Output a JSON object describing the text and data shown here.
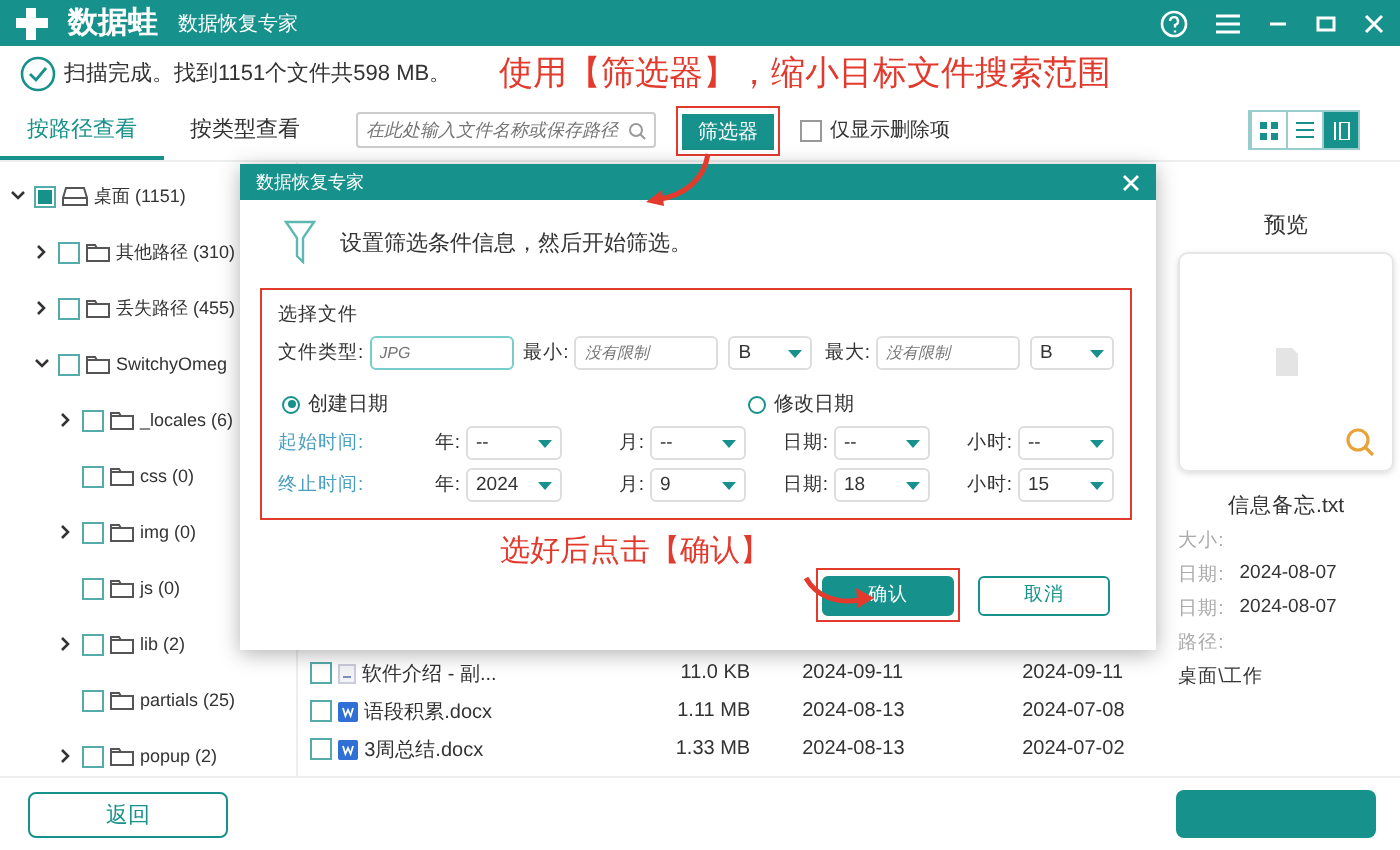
{
  "window": {
    "brand": "数据蛙",
    "title": "数据恢复专家"
  },
  "status": {
    "text": "扫描完成。找到1151个文件共598 MB。"
  },
  "top_note": "使用【筛选器】，缩小目标文件搜索范围",
  "view_tabs": [
    {
      "label": "按路径查看",
      "selected": true
    },
    {
      "label": "按类型查看",
      "selected": false
    }
  ],
  "search": {
    "placeholder": "在此处输入文件名称或保存路径"
  },
  "filter_button": {
    "label": "筛选器",
    "highlighted": true
  },
  "deleted_only": {
    "label": "仅显示删除项",
    "checked": false
  },
  "view_modes": [
    {
      "kind": "grid",
      "selected": false
    },
    {
      "kind": "list",
      "selected": false
    },
    {
      "kind": "detail",
      "selected": true
    }
  ],
  "tree": [
    {
      "label": "桌面 (1151)",
      "kind": "drive",
      "checked": true,
      "expanded": true,
      "children": [
        {
          "label": "其他路径 (310)",
          "kind": "folder",
          "checked": false,
          "expanded": false
        },
        {
          "label": "丢失路径 (455)",
          "kind": "folder",
          "checked": false,
          "expanded": false
        },
        {
          "label": "SwitchyOmeg",
          "kind": "folder",
          "checked": false,
          "expanded": true,
          "children": [
            {
              "label": "_locales (6)",
              "kind": "folder",
              "checked": false,
              "expanded": false
            },
            {
              "label": "css (0)",
              "kind": "folder",
              "checked": false
            },
            {
              "label": "img (0)",
              "kind": "folder",
              "checked": false,
              "expanded": false
            },
            {
              "label": "js (0)",
              "kind": "folder",
              "checked": false
            },
            {
              "label": "lib (2)",
              "kind": "folder",
              "checked": false,
              "expanded": false
            },
            {
              "label": "partials (25)",
              "kind": "folder",
              "checked": false
            },
            {
              "label": "popup (2)",
              "kind": "folder",
              "checked": false,
              "expanded": false
            }
          ]
        }
      ]
    }
  ],
  "files": [
    {
      "name": "软件介绍 - 副...",
      "kind": "text",
      "checked": false,
      "size": "11.0 KB",
      "date_1": "2024-09-11",
      "date_2": "2024-09-11"
    },
    {
      "name": "语段积累.docx",
      "kind": "word",
      "checked": false,
      "size": "1.11 MB",
      "date_1": "2024-08-13",
      "date_2": "2024-07-08"
    },
    {
      "name": "3周总结.docx",
      "kind": "word",
      "checked": false,
      "size": "1.33 MB",
      "date_1": "2024-08-13",
      "date_2": "2024-07-02"
    }
  ],
  "preview": {
    "title": "预览",
    "file_name": "信息备忘.txt",
    "details": [
      {
        "label": "大小:"
      },
      {
        "label": "日期:",
        "value": "2024-08-07"
      },
      {
        "label": "日期:",
        "value": "2024-08-07"
      },
      {
        "label": "路径:"
      }
    ],
    "path": "桌面\\工作"
  },
  "dialog": {
    "title": "数据恢复专家",
    "intro": "设置筛选条件信息，然后开始筛选。",
    "highlighted": true,
    "section_title": "选择文件",
    "file_type": {
      "label": "文件类型:",
      "placeholder": "JPG"
    },
    "min": {
      "label": "最小:",
      "placeholder": "没有限制",
      "unit": "B"
    },
    "max": {
      "label": "最大:",
      "placeholder": "没有限制",
      "unit": "B"
    },
    "date_modes": [
      {
        "label": "创建日期",
        "selected": true
      },
      {
        "label": "修改日期",
        "selected": false
      }
    ],
    "ranges": [
      {
        "label": "起始时间:",
        "fields": [
          {
            "label": "年:",
            "value": "--"
          },
          {
            "label": "月:",
            "value": "--"
          },
          {
            "label": "日期:",
            "value": "--"
          },
          {
            "label": "小时:",
            "value": "--"
          }
        ]
      },
      {
        "label": "终止时间:",
        "fields": [
          {
            "label": "年:",
            "value": "2024"
          },
          {
            "label": "月:",
            "value": "9"
          },
          {
            "label": "日期:",
            "value": "18"
          },
          {
            "label": "小时:",
            "value": "15"
          }
        ]
      }
    ],
    "note": "选好后点击【确认】",
    "buttons": [
      {
        "label": "确认",
        "kind": "primary",
        "highlighted": true
      },
      {
        "label": "取消",
        "kind": "secondary",
        "highlighted": false
      }
    ]
  },
  "footer": {
    "back": "返回",
    "action_button": {
      "kind": "primary"
    }
  }
}
